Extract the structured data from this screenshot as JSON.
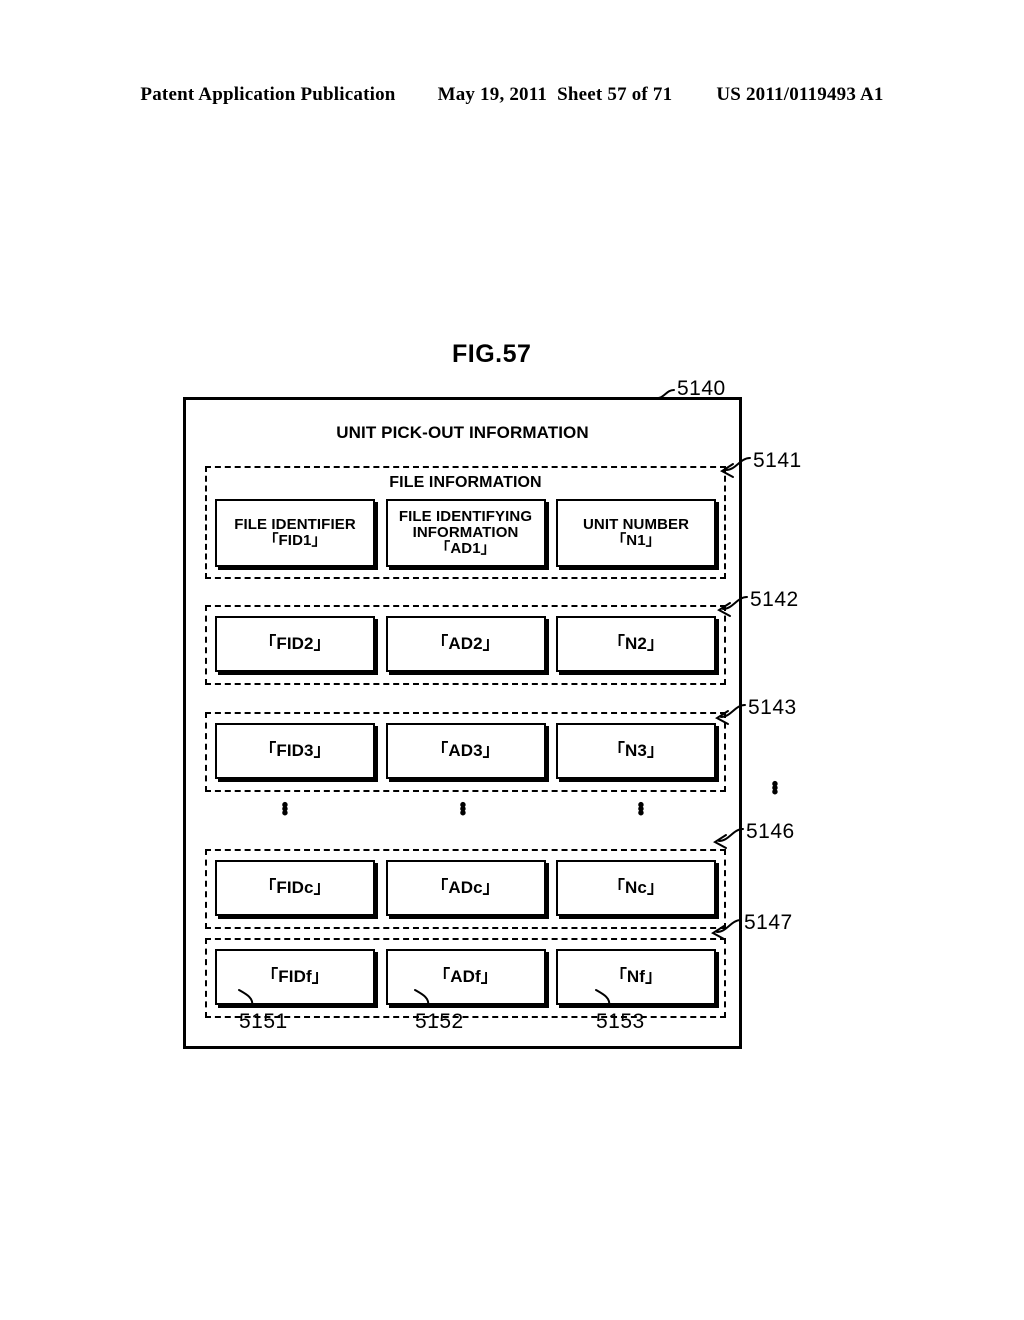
{
  "header": {
    "publication": "Patent Application Publication",
    "date": "May 19, 2011",
    "sheet": "Sheet 57 of 71",
    "patent_number": "US 2011/0119493 A1"
  },
  "figure": {
    "title": "FIG.57",
    "frame_ref": "5140",
    "main_title": "UNIT PICK-OUT INFORMATION",
    "group_sublabel": "FILE INFORMATION",
    "ellipsis": "⋮"
  },
  "columns": [
    {
      "header": "FILE IDENTIFIER",
      "ref": "5151"
    },
    {
      "header": "FILE IDENTIFYING INFORMATION",
      "ref": "5152"
    },
    {
      "header": "UNIT NUMBER",
      "ref": "5153"
    }
  ],
  "column_headers": {
    "file_identifier": "FILE IDENTIFIER",
    "file_identifying_information_line1": "FILE IDENTIFYING",
    "file_identifying_information_line2": "INFORMATION",
    "unit_number": "UNIT NUMBER"
  },
  "records": [
    {
      "ref": "5141",
      "has_sublabel": true,
      "has_column_headers": true,
      "file_identifier": "「FID1」",
      "file_identifying_information": "「AD1」",
      "unit_number": "「N1」"
    },
    {
      "ref": "5142",
      "has_sublabel": false,
      "has_column_headers": false,
      "file_identifier": "「FID2」",
      "file_identifying_information": "「AD2」",
      "unit_number": "「N2」"
    },
    {
      "ref": "5143",
      "has_sublabel": false,
      "has_column_headers": false,
      "file_identifier": "「FID3」",
      "file_identifying_information": "「AD3」",
      "unit_number": "「N3」"
    },
    {
      "ref": "5146",
      "has_sublabel": false,
      "has_column_headers": false,
      "file_identifier": "「FIDc」",
      "file_identifying_information": "「ADc」",
      "unit_number": "「Nc」"
    },
    {
      "ref": "5147",
      "has_sublabel": false,
      "has_column_headers": false,
      "file_identifier": "「FIDf」",
      "file_identifying_information": "「ADf」",
      "unit_number": "「Nf」"
    }
  ],
  "dots": {
    "d1": "•",
    "d2": "•",
    "d3": "•"
  },
  "colors": {
    "ink": "#000000",
    "page": "#ffffff"
  }
}
